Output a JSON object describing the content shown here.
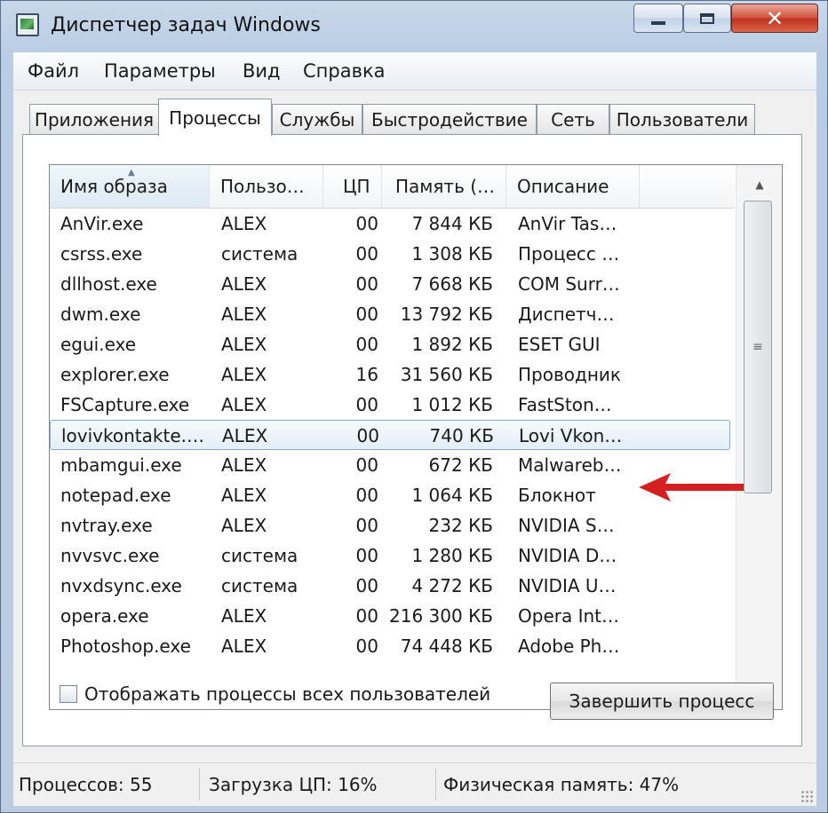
{
  "window": {
    "title": "Диспетчер задач Windows",
    "close_glyph": "✕"
  },
  "menu": [
    "Файл",
    "Параметры",
    "Вид",
    "Справка"
  ],
  "tabs": [
    "Приложения",
    "Процессы",
    "Службы",
    "Быстродействие",
    "Сеть",
    "Пользователи"
  ],
  "active_tab": "Процессы",
  "columns": {
    "name": "Имя образа",
    "user": "Пользо…",
    "cpu": "ЦП",
    "memory": "Память (…",
    "description": "Описание"
  },
  "processes": [
    {
      "name": "AnVir.exe",
      "user": "ALEX",
      "cpu": "00",
      "memory": "7 844 КБ",
      "description": "AnVir Tas…"
    },
    {
      "name": "csrss.exe",
      "user": "система",
      "cpu": "00",
      "memory": "1 308 КБ",
      "description": "Процесс …"
    },
    {
      "name": "dllhost.exe",
      "user": "ALEX",
      "cpu": "00",
      "memory": "7 668 КБ",
      "description": "COM Surr…"
    },
    {
      "name": "dwm.exe",
      "user": "ALEX",
      "cpu": "00",
      "memory": "13 792 КБ",
      "description": "Диспетч…"
    },
    {
      "name": "egui.exe",
      "user": "ALEX",
      "cpu": "00",
      "memory": "1 892 КБ",
      "description": "ESET GUI"
    },
    {
      "name": "explorer.exe",
      "user": "ALEX",
      "cpu": "16",
      "memory": "31 560 КБ",
      "description": "Проводник"
    },
    {
      "name": "FSCapture.exe",
      "user": "ALEX",
      "cpu": "00",
      "memory": "1 012 КБ",
      "description": "FastSton…"
    },
    {
      "name": "lovivkontakte.…",
      "user": "ALEX",
      "cpu": "00",
      "memory": "740 КБ",
      "description": "Lovi Vkon…"
    },
    {
      "name": "mbamgui.exe",
      "user": "ALEX",
      "cpu": "00",
      "memory": "672 КБ",
      "description": "Malwareb…"
    },
    {
      "name": "notepad.exe",
      "user": "ALEX",
      "cpu": "00",
      "memory": "1 064 КБ",
      "description": "Блокнот"
    },
    {
      "name": "nvtray.exe",
      "user": "ALEX",
      "cpu": "00",
      "memory": "232 КБ",
      "description": "NVIDIA S…"
    },
    {
      "name": "nvvsvc.exe",
      "user": "система",
      "cpu": "00",
      "memory": "1 280 КБ",
      "description": "NVIDIA D…"
    },
    {
      "name": "nvxdsync.exe",
      "user": "система",
      "cpu": "00",
      "memory": "4 272 КБ",
      "description": "NVIDIA U…"
    },
    {
      "name": "opera.exe",
      "user": "ALEX",
      "cpu": "00",
      "memory": "216 300 КБ",
      "description": "Opera Int…"
    },
    {
      "name": "Photoshop.exe",
      "user": "ALEX",
      "cpu": "00",
      "memory": "74 448 КБ",
      "description": "Adobe Ph…"
    }
  ],
  "selected_process": "lovivkontakte.…",
  "show_all_users": {
    "label": "Отображать процессы всех пользователей",
    "checked": false
  },
  "end_process_label": "Завершить процесс",
  "status": {
    "processes": "Процессов: 55",
    "cpu_load": "Загрузка ЦП: 16%",
    "physical_memory": "Физическая память: 47%"
  },
  "annotation_color": "#d42020"
}
